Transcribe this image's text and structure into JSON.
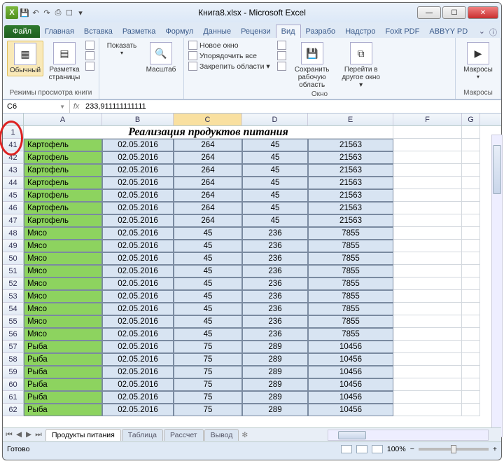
{
  "window": {
    "title": "Книга8.xlsx - Microsoft Excel"
  },
  "qat_icons": [
    "xl",
    "save",
    "undo",
    "redo",
    "print",
    "doc",
    "arrow"
  ],
  "tabs": {
    "file": "Файл",
    "items": [
      "Главная",
      "Вставка",
      "Разметка",
      "Формул",
      "Данные",
      "Рецензи",
      "Вид",
      "Разрабо",
      "Надстро",
      "Foxit PDF",
      "ABBYY PD"
    ],
    "active": "Вид"
  },
  "ribbon": {
    "group1": {
      "btn1": "Обычный",
      "btn2": "Разметка\nстраницы",
      "label": "Режимы просмотра книги"
    },
    "group2": {
      "btn1": "Показать",
      "btn2": "Масштаб"
    },
    "group3": {
      "i1": "Новое окно",
      "i2": "Упорядочить все",
      "i3": "Закрепить области ▾",
      "label": "Окно",
      "btn1": "Сохранить\nрабочую область",
      "btn2": "Перейти в\nдругое окно ▾"
    },
    "group4": {
      "btn": "Макросы",
      "label": "Макросы"
    }
  },
  "formula": {
    "cell": "C6",
    "fx": "fx",
    "value": "233,911111111111"
  },
  "cols": [
    "A",
    "B",
    "C",
    "D",
    "E",
    "F",
    "G"
  ],
  "titlerow": {
    "num": "1",
    "text": "Реализация продуктов питания"
  },
  "rows": [
    {
      "n": "41",
      "a": "Картофель",
      "b": "02.05.2016",
      "c": "264",
      "d": "45",
      "e": "21563"
    },
    {
      "n": "42",
      "a": "Картофель",
      "b": "02.05.2016",
      "c": "264",
      "d": "45",
      "e": "21563"
    },
    {
      "n": "43",
      "a": "Картофель",
      "b": "02.05.2016",
      "c": "264",
      "d": "45",
      "e": "21563"
    },
    {
      "n": "44",
      "a": "Картофель",
      "b": "02.05.2016",
      "c": "264",
      "d": "45",
      "e": "21563"
    },
    {
      "n": "45",
      "a": "Картофель",
      "b": "02.05.2016",
      "c": "264",
      "d": "45",
      "e": "21563"
    },
    {
      "n": "46",
      "a": "Картофель",
      "b": "02.05.2016",
      "c": "264",
      "d": "45",
      "e": "21563"
    },
    {
      "n": "47",
      "a": "Картофель",
      "b": "02.05.2016",
      "c": "264",
      "d": "45",
      "e": "21563"
    },
    {
      "n": "48",
      "a": "Мясо",
      "b": "02.05.2016",
      "c": "45",
      "d": "236",
      "e": "7855"
    },
    {
      "n": "49",
      "a": "Мясо",
      "b": "02.05.2016",
      "c": "45",
      "d": "236",
      "e": "7855"
    },
    {
      "n": "50",
      "a": "Мясо",
      "b": "02.05.2016",
      "c": "45",
      "d": "236",
      "e": "7855"
    },
    {
      "n": "51",
      "a": "Мясо",
      "b": "02.05.2016",
      "c": "45",
      "d": "236",
      "e": "7855"
    },
    {
      "n": "52",
      "a": "Мясо",
      "b": "02.05.2016",
      "c": "45",
      "d": "236",
      "e": "7855"
    },
    {
      "n": "53",
      "a": "Мясо",
      "b": "02.05.2016",
      "c": "45",
      "d": "236",
      "e": "7855"
    },
    {
      "n": "54",
      "a": "Мясо",
      "b": "02.05.2016",
      "c": "45",
      "d": "236",
      "e": "7855"
    },
    {
      "n": "55",
      "a": "Мясо",
      "b": "02.05.2016",
      "c": "45",
      "d": "236",
      "e": "7855"
    },
    {
      "n": "56",
      "a": "Мясо",
      "b": "02.05.2016",
      "c": "45",
      "d": "236",
      "e": "7855"
    },
    {
      "n": "57",
      "a": "Рыба",
      "b": "02.05.2016",
      "c": "75",
      "d": "289",
      "e": "10456"
    },
    {
      "n": "58",
      "a": "Рыба",
      "b": "02.05.2016",
      "c": "75",
      "d": "289",
      "e": "10456"
    },
    {
      "n": "59",
      "a": "Рыба",
      "b": "02.05.2016",
      "c": "75",
      "d": "289",
      "e": "10456"
    },
    {
      "n": "60",
      "a": "Рыба",
      "b": "02.05.2016",
      "c": "75",
      "d": "289",
      "e": "10456"
    },
    {
      "n": "61",
      "a": "Рыба",
      "b": "02.05.2016",
      "c": "75",
      "d": "289",
      "e": "10456"
    },
    {
      "n": "62",
      "a": "Рыба",
      "b": "02.05.2016",
      "c": "75",
      "d": "289",
      "e": "10456"
    }
  ],
  "sheets": {
    "active": "Продукты питания",
    "others": [
      "Таблица",
      "Рассчет",
      "Вывод"
    ]
  },
  "status": {
    "ready": "Готово",
    "zoom": "100%"
  }
}
